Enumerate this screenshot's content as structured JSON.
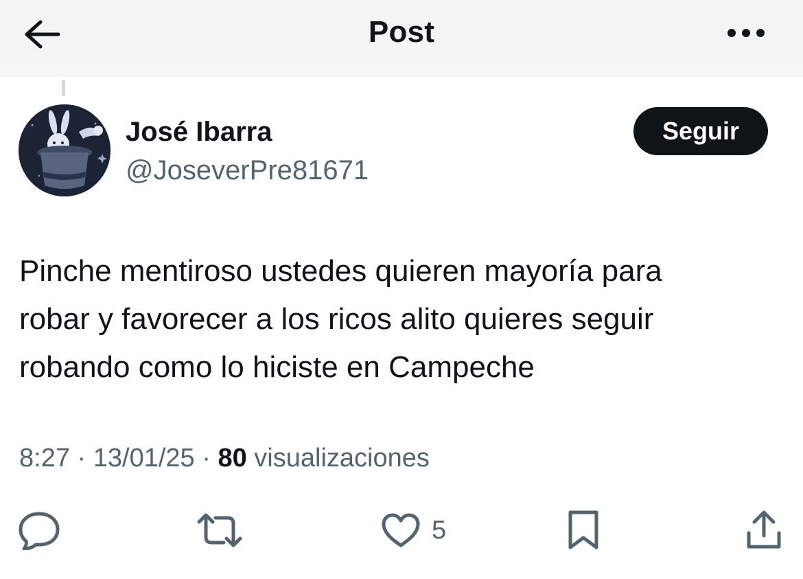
{
  "header": {
    "title": "Post",
    "back_icon": "arrow-left-icon",
    "more_icon": "more-horizontal-icon"
  },
  "author": {
    "name": "José Ibarra",
    "handle": "@JoseverPre81671",
    "avatar_icon": "magician-hat-rabbit-avatar"
  },
  "follow_button": {
    "label": "Seguir"
  },
  "post": {
    "lines": [
      "Pinche mentiroso ustedes quieren mayoría para",
      "robar y favorecer a los ricos alito quieres seguir",
      "robando como lo hiciste en Campeche"
    ]
  },
  "meta": {
    "time": "8:27",
    "separator": "·",
    "date": "13/01/25",
    "views_count": "80",
    "views_label": "visualizaciones"
  },
  "actions": {
    "reply_icon": "reply-icon",
    "repost_icon": "repost-icon",
    "like_icon": "heart-icon",
    "like_count": "5",
    "bookmark_icon": "bookmark-icon",
    "share_icon": "share-icon"
  },
  "colors": {
    "text_primary": "#0f1419",
    "text_secondary": "#536471",
    "button_bg": "#0f1419",
    "button_text": "#ffffff",
    "header_bg": "#f3f3f3"
  }
}
